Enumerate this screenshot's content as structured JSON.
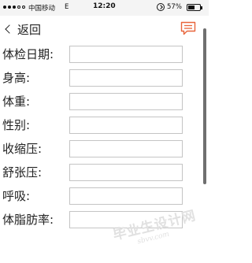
{
  "status_bar": {
    "carrier": "中国移动",
    "network": "E",
    "time": "12:20",
    "battery": "57%",
    "battery_level": 0.57
  },
  "nav": {
    "back_label": "返回",
    "back_icon": "chevron-left-icon",
    "message_icon": "message-icon",
    "accent_color": "#e8643a"
  },
  "form": {
    "fields": [
      {
        "label": "体检日期:",
        "value": ""
      },
      {
        "label": "身高:",
        "value": ""
      },
      {
        "label": "体重:",
        "value": ""
      },
      {
        "label": "性别:",
        "value": ""
      },
      {
        "label": "收缩压:",
        "value": ""
      },
      {
        "label": "舒张压:",
        "value": ""
      },
      {
        "label": "呼吸:",
        "value": ""
      },
      {
        "label": "体脂肪率:",
        "value": ""
      }
    ]
  },
  "watermark": {
    "text": "毕业生设计网",
    "url": "sbvv.com"
  }
}
